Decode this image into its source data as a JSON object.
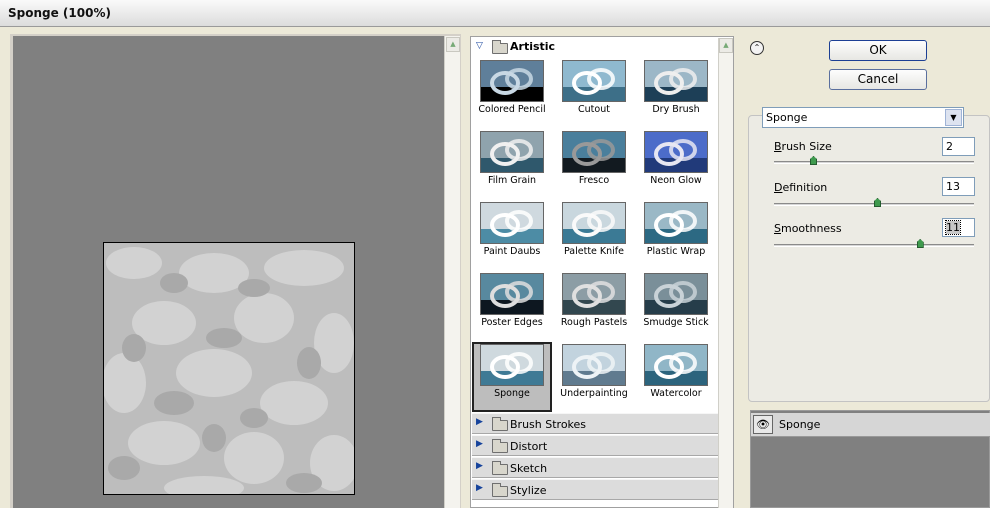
{
  "window": {
    "title": "Sponge (100%)"
  },
  "gallery": {
    "open_category": "Artistic",
    "thumbnails": [
      "Colored Pencil",
      "Cutout",
      "Dry Brush",
      "Film Grain",
      "Fresco",
      "Neon Glow",
      "Paint Daubs",
      "Palette Knife",
      "Plastic Wrap",
      "Poster Edges",
      "Rough Pastels",
      "Smudge Stick",
      "Sponge",
      "Underpainting",
      "Watercolor"
    ],
    "selected": "Sponge",
    "categories": [
      "Brush Strokes",
      "Distort",
      "Sketch",
      "Stylize"
    ]
  },
  "buttons": {
    "ok": "OK",
    "cancel": "Cancel"
  },
  "filter_select": {
    "value": "Sponge"
  },
  "params": {
    "brush_size": {
      "accel": "B",
      "rest": "rush Size",
      "value": "2",
      "max": 10
    },
    "definition": {
      "accel": "D",
      "rest": "efinition",
      "value": "13",
      "max": 25
    },
    "smoothness": {
      "accel": "S",
      "rest": "moothness",
      "value": "11",
      "max": 15
    }
  },
  "layers": [
    {
      "name": "Sponge",
      "visible": true
    }
  ],
  "colors": {
    "accent": "#1c3f94",
    "preview_bg": "#808080",
    "slider_thumb": "#3f9a4e"
  },
  "icons": {
    "triangle_open": "▽",
    "triangle_closed": "▶",
    "eye": "👁",
    "collapse": "⌃",
    "dropdown": "▼"
  }
}
